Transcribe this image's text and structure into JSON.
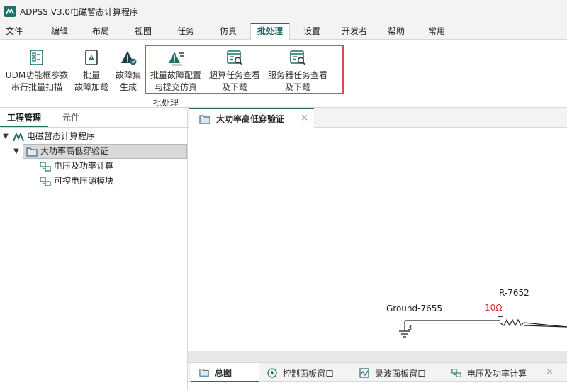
{
  "window": {
    "title": "ADPSS V3.0电磁暂态计算程序"
  },
  "menu": {
    "items": [
      {
        "label": "文件"
      },
      {
        "label": "编辑"
      },
      {
        "label": "布局"
      },
      {
        "label": "视图"
      },
      {
        "label": "任务"
      },
      {
        "label": "仿真"
      },
      {
        "label": "批处理"
      },
      {
        "label": "设置"
      },
      {
        "label": "开发者"
      },
      {
        "label": "帮助"
      },
      {
        "label": "常用"
      }
    ],
    "active": "批处理"
  },
  "ribbon": {
    "buttons": [
      {
        "label": "UDM功能框参数\n串行批量扫描",
        "icon": "batch-scan-icon"
      },
      {
        "label": "批量\n故障加载",
        "icon": "batch-fault-load-icon"
      },
      {
        "label": "故障集\n生成",
        "icon": "fault-set-icon"
      },
      {
        "label": "批量故障配置\n与提交仿真",
        "icon": "batch-fault-config-icon"
      },
      {
        "label": "超算任务查看\n及下载",
        "icon": "hpc-task-view-icon"
      },
      {
        "label": "服务器任务查看\n及下载",
        "icon": "server-task-view-icon"
      }
    ],
    "group_label": "批处理",
    "accent": "#1f6f6a",
    "highlight_color": "#e04a4a"
  },
  "left_panel": {
    "tabs": [
      {
        "label": "工程管理"
      },
      {
        "label": "元件"
      }
    ],
    "tree": [
      {
        "label": "电磁暂态计算程序",
        "icon": "app-logo-icon",
        "level": 0
      },
      {
        "label": "大功率高低穿验证",
        "icon": "folder-icon",
        "level": 1,
        "selected": true
      },
      {
        "label": "电压及功率计算",
        "icon": "subsystem-icon",
        "level": 2
      },
      {
        "label": "可控电压源模块",
        "icon": "subsystem-icon",
        "level": 2
      }
    ]
  },
  "document": {
    "tab_label": "大功率高低穿验证",
    "close_glyph": "×",
    "schematic": {
      "ground_label": "Ground-7655",
      "ground_pin": "3",
      "resistor_label": "R-7652",
      "resistor_value": "10Ω",
      "resistor_value_color": "#e03030",
      "resistor_plus": "+"
    }
  },
  "bottom_tabs": {
    "items": [
      {
        "label": "总图",
        "icon": "folder-icon",
        "active": true
      },
      {
        "label": "控制面板窗口",
        "icon": "control-panel-icon"
      },
      {
        "label": "录波面板窗口",
        "icon": "waveform-icon"
      },
      {
        "label": "电压及功率计算",
        "icon": "subsystem-icon"
      }
    ],
    "close_glyph": "×"
  }
}
